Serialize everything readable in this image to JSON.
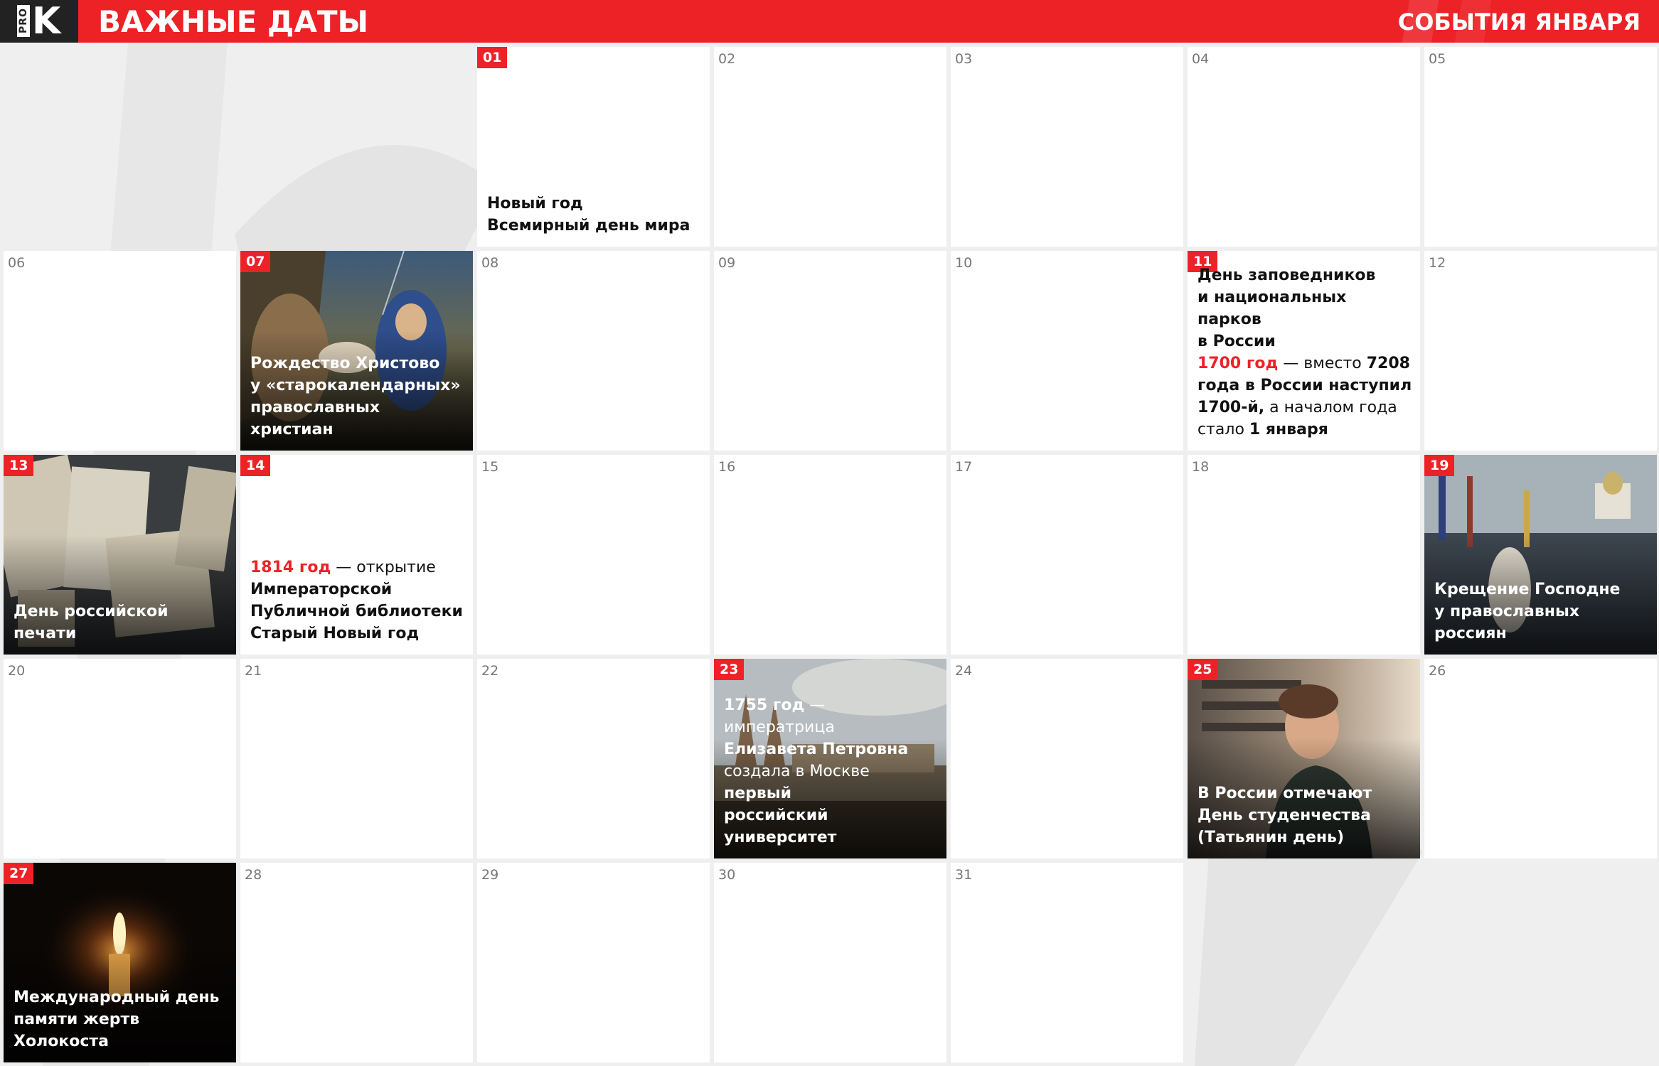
{
  "header": {
    "logo_pro": "PRO",
    "logo_k": "K",
    "title": "ВАЖНЫЕ ДАТЫ",
    "subtitle": "СОБЫТИЯ ЯНВАРЯ"
  },
  "calendar": {
    "d01": {
      "num": "01",
      "lines": [
        "Новый год",
        "Всемирный день мира"
      ]
    },
    "d02": "02",
    "d03": "03",
    "d04": "04",
    "d05": "05",
    "d06": "06",
    "d07": {
      "num": "07",
      "lines": [
        "Рождество Христово",
        "у «старокалендарных»",
        "православных христиан"
      ],
      "image": "nativity-icon-painting"
    },
    "d08": "08",
    "d09": "09",
    "d10": "10",
    "d11": {
      "num": "11",
      "l1": "День заповедников",
      "l2": "и национальных парков",
      "l3": "в России",
      "l4a": "1700 год",
      "l4b": " — вместо ",
      "l4c": "7208",
      "l5": "года в России наступил",
      "l6a": "1700-й,",
      "l6b": " а началом года",
      "l7a": "стало ",
      "l7b": "1 января"
    },
    "d12": "12",
    "d13": {
      "num": "13",
      "lines": [
        "День российской печати"
      ],
      "image": "old-printed-books-photo"
    },
    "d14": {
      "num": "14",
      "l1a": "1814 год",
      "l1b": " — открытие",
      "l2": "Императорской",
      "l3": "Публичной библиотеки",
      "l4": "Старый Новый год"
    },
    "d15": "15",
    "d16": "16",
    "d17": "17",
    "d18": "18",
    "d19": {
      "num": "19",
      "lines": [
        "Крещение Господне",
        "у православных россиян"
      ],
      "image": "epiphany-procession-painting"
    },
    "d20": "20",
    "d21": "21",
    "d22": "22",
    "d23": {
      "num": "23",
      "l1a": "1755 год",
      "l1b": " — императрица",
      "l2": "Елизавета Петровна",
      "l3a": "создала в Москве ",
      "l3b": "первый",
      "l4": "российский университет",
      "image": "moscow-old-university-painting"
    },
    "d24": "24",
    "d25": {
      "num": "25",
      "lines": [
        "В России отмечают",
        "День студенчества",
        "(Татьянин день)"
      ],
      "image": "smiling-student-photo"
    },
    "d26": "26",
    "d27": {
      "num": "27",
      "lines": [
        "Международный день",
        "памяти жертв Холокоста"
      ],
      "image": "memorial-candle-photo"
    },
    "d28": "28",
    "d29": "29",
    "d30": "30",
    "d31": "31"
  },
  "colors": {
    "accent": "#ed2227",
    "background": "#efefef"
  }
}
